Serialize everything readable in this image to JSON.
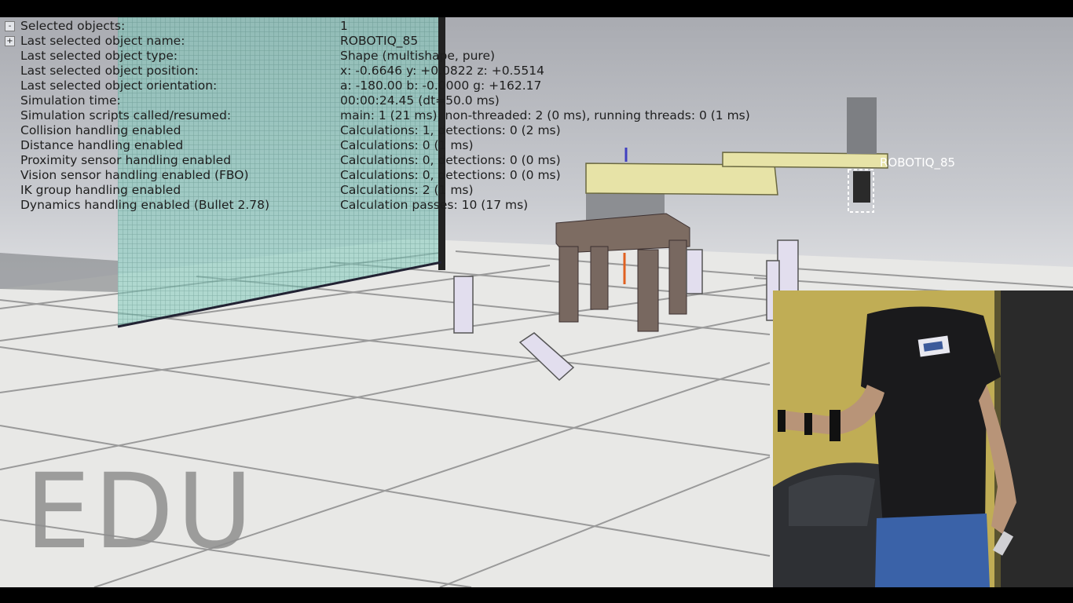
{
  "info_panel": {
    "rows": [
      {
        "label": "Selected objects:",
        "value": "1"
      },
      {
        "label": "Last selected object name:",
        "value": "ROBOTIQ_85"
      },
      {
        "label": "Last selected object type:",
        "value": "Shape (multishape, pure)"
      },
      {
        "label": "Last selected object position:",
        "value": "x: -0.6646   y: +0.0822   z: +0.5514"
      },
      {
        "label": "Last selected object orientation:",
        "value": "a: -180.00   b: -0.0000   g: +162.17"
      },
      {
        "label": "Simulation time:",
        "value": "00:00:24.45 (dt=50.0 ms)"
      },
      {
        "label": "Simulation scripts called/resumed:",
        "value": "main: 1 (21 ms), non-threaded: 2 (0 ms), running threads: 0 (1 ms)"
      },
      {
        "label": "Collision handling enabled",
        "value": "Calculations: 1, detections: 0 (2 ms)"
      },
      {
        "label": "Distance handling enabled",
        "value": "Calculations: 0 (1 ms)"
      },
      {
        "label": "Proximity sensor handling enabled",
        "value": "Calculations: 0, detections: 0 (0 ms)"
      },
      {
        "label": "Vision sensor handling enabled (FBO)",
        "value": "Calculations: 0, detections: 0 (0 ms)"
      },
      {
        "label": "IK group handling enabled",
        "value": "Calculations: 2 (1 ms)"
      },
      {
        "label": "Dynamics handling enabled (Bullet 2.78)",
        "value": "Calculation passes: 10 (17 ms)"
      }
    ],
    "toggle_collapse": "-",
    "toggle_expand": "+"
  },
  "scene": {
    "object_label": "ROBOTIQ_85"
  },
  "watermark": "EDU",
  "colors": {
    "floor_light": "#ebebea",
    "floor_line": "#8e8e8e",
    "robot_arm": "#e8e4a8",
    "robot_base": "#8a8c90",
    "table_wood": "#7a6a60",
    "glass_wall": "#74c6b4",
    "watermark": "#8f8f8f"
  }
}
